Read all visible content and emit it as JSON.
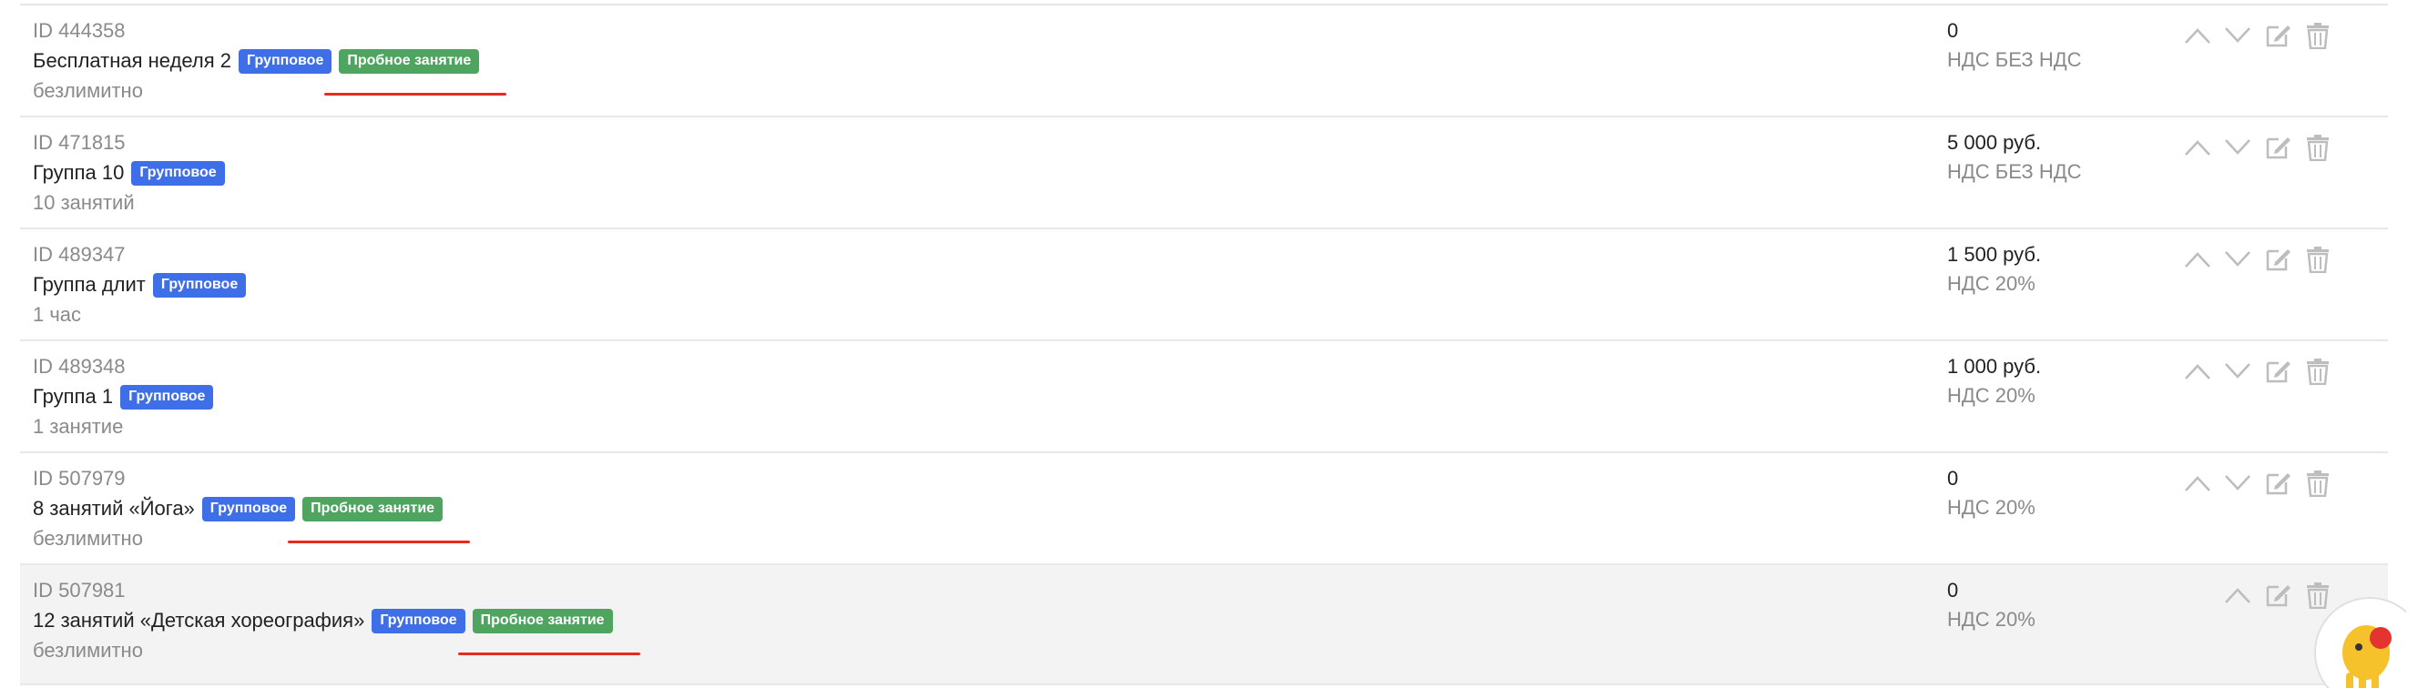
{
  "rows": [
    {
      "id": "ID 444358",
      "name": "Бесплатная неделя 2",
      "badge_group": "Групповое",
      "badge_trial": "Пробное занятие",
      "sub": "безлимитно",
      "price": "0",
      "vat": "НДС БЕЗ НДС"
    },
    {
      "id": "ID 471815",
      "name": "Группа 10",
      "badge_group": "Групповое",
      "sub": "10 занятий",
      "price": "5 000 руб.",
      "vat": "НДС БЕЗ НДС"
    },
    {
      "id": "ID 489347",
      "name": "Группа длит",
      "badge_group": "Групповое",
      "sub": "1 час",
      "price": "1 500 руб.",
      "vat": "НДС 20%"
    },
    {
      "id": "ID 489348",
      "name": "Группа 1",
      "badge_group": "Групповое",
      "sub": "1 занятие",
      "price": "1 000 руб.",
      "vat": "НДС 20%"
    },
    {
      "id": "ID 507979",
      "name": "8 занятий «Йога»",
      "badge_group": "Групповое",
      "badge_trial": "Пробное занятие",
      "sub": "безлимитно",
      "price": "0",
      "vat": "НДС 20%"
    },
    {
      "id": "ID 507981",
      "name": "12 занятий «Детская хореография»",
      "badge_group": "Групповое",
      "badge_trial": "Пробное занятие",
      "sub": "безлимитно",
      "price": "0",
      "vat": "НДС 20%"
    }
  ],
  "icons": {
    "up": "chevron-up-icon",
    "down": "chevron-down-icon",
    "edit": "edit-icon",
    "delete": "trash-icon"
  },
  "colors": {
    "badge_group": "#3e6ee8",
    "badge_trial": "#4fa45f",
    "underline": "#e52b1e",
    "icon": "#bdbdbd"
  }
}
